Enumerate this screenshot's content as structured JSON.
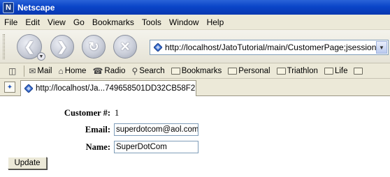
{
  "window": {
    "title": "Netscape",
    "logo_letter": "N"
  },
  "menu": [
    "File",
    "Edit",
    "View",
    "Go",
    "Bookmarks",
    "Tools",
    "Window",
    "Help"
  ],
  "address_bar": {
    "url": "http://localhost/JatoTutorial/main/CustomerPage;jsessionid=E"
  },
  "personal_toolbar": {
    "items": [
      "Mail",
      "Home",
      "Radio",
      "Search"
    ],
    "folders": [
      "Bookmarks",
      "Personal",
      "Triathlon",
      "Life"
    ]
  },
  "tab": {
    "label": "http://localhost/Ja...749658501DD32CB58F2"
  },
  "form": {
    "customer_label": "Customer #:",
    "customer_value": "1",
    "email_label": "Email:",
    "email_value": "superdotcom@aol.com",
    "name_label": "Name:",
    "name_value": "SuperDotCom",
    "update_label": "Update"
  },
  "icons": {
    "back": "back-arrow-icon",
    "forward": "forward-arrow-icon",
    "reload": "reload-icon",
    "stop": "stop-icon",
    "mail": "mail-icon",
    "home": "home-icon",
    "radio": "radio-icon",
    "search": "search-icon"
  },
  "colors": {
    "titlebar": "#0a45c8",
    "chrome": "#ece9d8",
    "input_border": "#7f9db9"
  }
}
